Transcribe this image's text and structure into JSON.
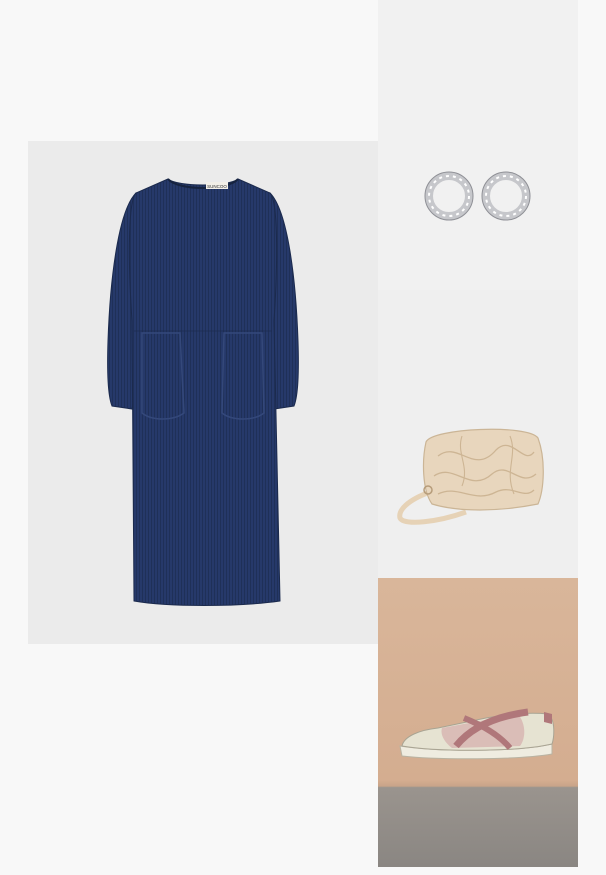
{
  "outfit": {
    "items": [
      {
        "key": "dress",
        "icon": "dress-icon",
        "color": "#23375f"
      },
      {
        "key": "earrings",
        "icon": "hoop-earrings-icon",
        "color": "#c9c9cc"
      },
      {
        "key": "bag",
        "icon": "quilted-bag-icon",
        "color": "#e8d6bd"
      },
      {
        "key": "shoe",
        "icon": "ballet-sneaker-icon",
        "color": "#e6e3d2"
      }
    ],
    "dress_label_text": "SUNCOO"
  }
}
